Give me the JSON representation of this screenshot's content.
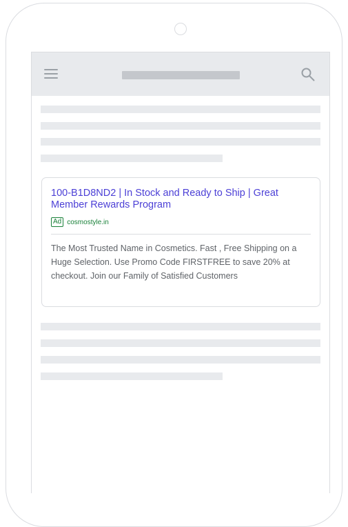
{
  "header": {
    "menu_icon": "hamburger-menu-icon",
    "search_icon": "search-icon"
  },
  "ad": {
    "title": "100-B1D8ND2 | In Stock and Ready to Ship | Great Member Rewards Program",
    "badge": "Ad",
    "display_url": "cosmostyle.in",
    "description": "The Most Trusted Name in Cosmetics. Fast , Free Shipping on a Huge Selection. Use Promo Code FIRSTFREE to save 20% at checkout. Join our Family of Satisfied Customers"
  },
  "colors": {
    "ad_title": "#4b3fd6",
    "ad_url": "#188038",
    "skeleton": "#e8eaed",
    "topbar": "#e8eaed",
    "frame": "#dadce0"
  }
}
